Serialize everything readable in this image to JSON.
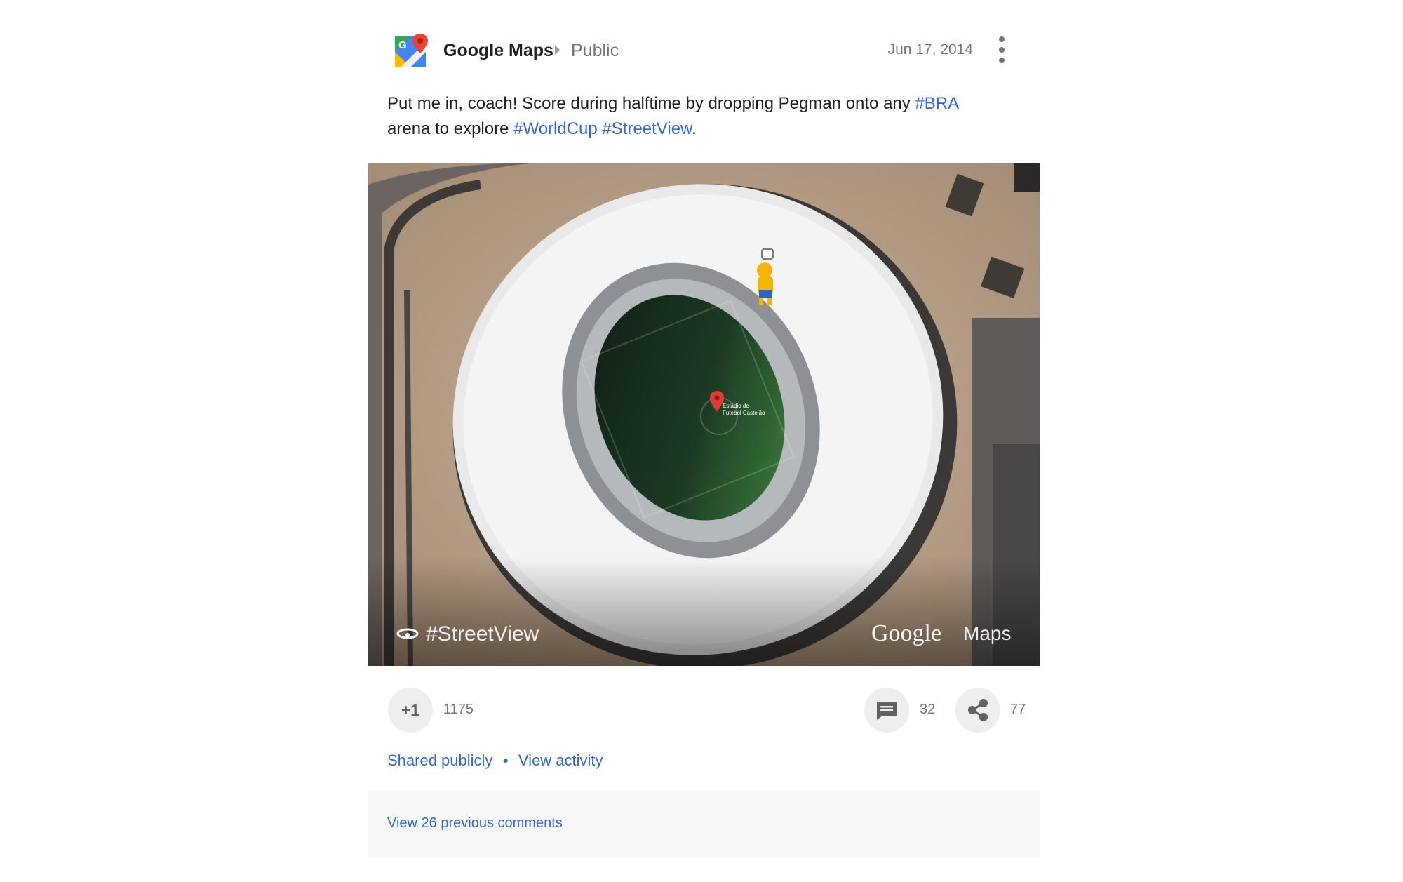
{
  "header": {
    "author": "Google Maps",
    "visibility": "Public",
    "date": "Jun 17, 2014",
    "menu_icon": "more-vert-icon",
    "logo_icon": "google-maps-logo"
  },
  "post": {
    "text_1": "Put me in, coach! Score during halftime by dropping Pegman onto any ",
    "hashtag_bra": "#BRA",
    "text_2": "arena to explore ",
    "hashtag_worldcup": "#WorldCup",
    "hashtag_streetview": "#StreetView",
    "text_3": "."
  },
  "image": {
    "watermark_left": "#StreetView",
    "watermark_brand": "Google",
    "watermark_product": "Maps",
    "pin_label_line1": "Estádio de",
    "pin_label_line2": "Futebol Castelão"
  },
  "actions": {
    "plusone_label": "+1",
    "plusone_count": "1175",
    "comment_icon": "comment-icon",
    "comment_count": "32",
    "share_icon": "share-icon",
    "share_count": "77"
  },
  "links": {
    "shared": "Shared publicly",
    "activity": "View activity"
  },
  "comments": {
    "view_previous": "View 26 previous comments"
  },
  "colors": {
    "link": "#3367d6",
    "text": "#212121",
    "muted": "#757575",
    "button_bg": "#eeeeee"
  }
}
